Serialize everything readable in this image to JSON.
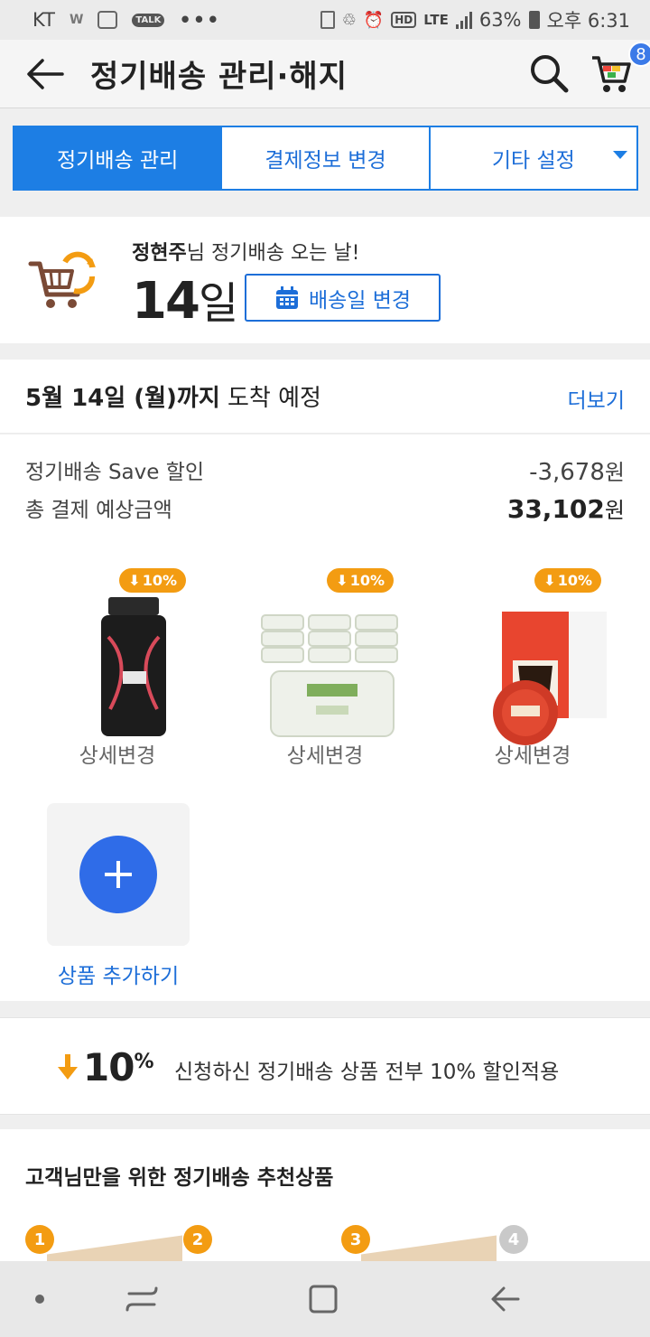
{
  "status_bar": {
    "carrier": "KT",
    "network": "LTE",
    "hd": "HD",
    "battery": "63%",
    "time": "오후 6:31"
  },
  "header": {
    "title": "정기배송 관리·해지",
    "cart_count": "8",
    "icons": [
      "back-arrow-icon",
      "search-icon",
      "cart-icon"
    ]
  },
  "tabs": [
    {
      "label": "정기배송 관리",
      "active": true
    },
    {
      "label": "결제정보 변경",
      "active": false
    },
    {
      "label": "기타 설정",
      "active": false
    }
  ],
  "delivery": {
    "customer_name": "정현주",
    "message_suffix": "님 정기배송 오는 날!",
    "day_number": "14",
    "day_unit": "일",
    "change_button": "배송일 변경"
  },
  "arrival": {
    "date_bold": "5월 14일 (월)까지",
    "date_rest": " 도착 예정",
    "more_link": "더보기"
  },
  "payment": {
    "save_label": "정기배송 Save 할인",
    "save_value": "-3,678",
    "total_label": "총 결제 예상금액",
    "total_value": "33,102",
    "currency": "원"
  },
  "products": [
    {
      "badge": "10%",
      "detail_link": "상세변경",
      "image": "supplement-bottle"
    },
    {
      "badge": "10%",
      "detail_link": "상세변경",
      "image": "bebesup-wipes"
    },
    {
      "badge": "10%",
      "detail_link": "상세변경",
      "image": "dolce-gusto-capsules"
    }
  ],
  "add_product": {
    "label": "상품 추가하기"
  },
  "discount_banner": {
    "number": "10",
    "percent": "%",
    "text": "신청하신 정기배송 상품 전부 10% 할인적용"
  },
  "recommend": {
    "title": "고객님만을 위한 정기배송 추천상품",
    "ranks": [
      "1",
      "2",
      "3",
      "4"
    ]
  },
  "colors": {
    "primary_blue": "#1d7ee4",
    "orange": "#f39c12",
    "add_button_blue": "#2f6ce8"
  }
}
